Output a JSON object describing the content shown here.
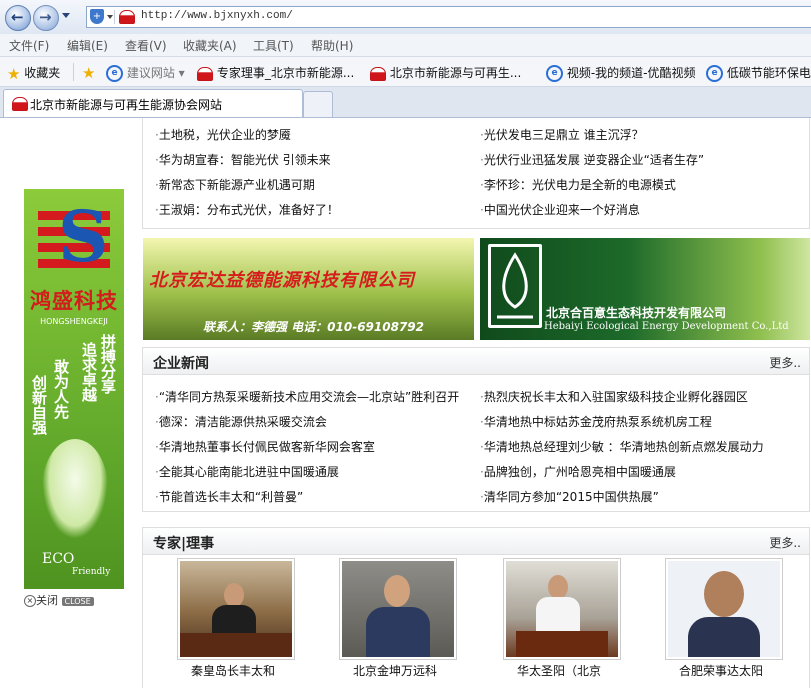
{
  "browser": {
    "url": "http://www.bjxnyxh.com/",
    "menu": [
      "文件(F)",
      "编辑(E)",
      "查看(V)",
      "收藏夹(A)",
      "工具(T)",
      "帮助(H)"
    ],
    "favorites_label": "收藏夹",
    "favorites": [
      "建议网站 ▾",
      "专家理事_北京市新能源...",
      "北京市新能源与可再生...",
      "视频-我的频道-优酷视频",
      "低碳节能环保电"
    ],
    "tab_title": "北京市新能源与可再生能源协会网站"
  },
  "top_news": {
    "left": [
      "土地税，光伏企业的梦魇",
      "华为胡宣春：智能光伏 引领未来",
      "新常态下新能源产业机遇可期",
      "王淑娟：分布式光伏，准备好了！"
    ],
    "right": [
      "光伏发电三足鼎立 谁主沉浮？",
      "光伏行业迅猛发展 逆变器企业“适者生存”",
      "李怀珍：光伏电力是全新的电源模式",
      "中国光伏企业迎来一个好消息"
    ]
  },
  "side_ad": {
    "name": "鸿盛科技",
    "pinyin": "HONGSHENGKEJI",
    "slogans": [
      "拼搏分享",
      "追求卓越",
      "敢为人先",
      "创新自强"
    ],
    "eco": "ECO",
    "friendly": "Friendly",
    "close_label": "关闭",
    "close_badge": "CLOSE"
  },
  "banners": {
    "b1_company": "北京宏达益德能源科技有限公司",
    "b1_contact": "联系人：李德强 电话：010-69108792",
    "b2_company": "北京合百意生态科技开发有限公司",
    "b2_en": "Hebaiyi Ecological Energy Development Co.,Ltd"
  },
  "enterprise_news": {
    "title": "企业新闻",
    "more": "更多..",
    "left": [
      "“清华同方热泵采暖新技术应用交流会—北京站”胜利召开",
      "德深：清洁能源供热采暖交流会",
      "华清地热董事长付佩民做客新华网会客室",
      "全能其心能南能北进驻中国暖通展",
      "节能首选长丰太和“利普曼”"
    ],
    "right": [
      "热烈庆祝长丰太和入驻国家级科技企业孵化器园区",
      "华清地热中标姑苏金茂府热泵系统机房工程",
      "华清地热总经理刘少敏 ：华清地热创新点燃发展动力",
      "品牌独创，广州哈恩亮相中国暖通展",
      "清华同方参加“2015中国供热展”"
    ]
  },
  "experts": {
    "title": "专家|理事",
    "more": "更多..",
    "people": [
      "秦皇岛长丰太和",
      "北京金坤万远科",
      "华太圣阳（北京",
      "合肥荣事达太阳"
    ]
  }
}
